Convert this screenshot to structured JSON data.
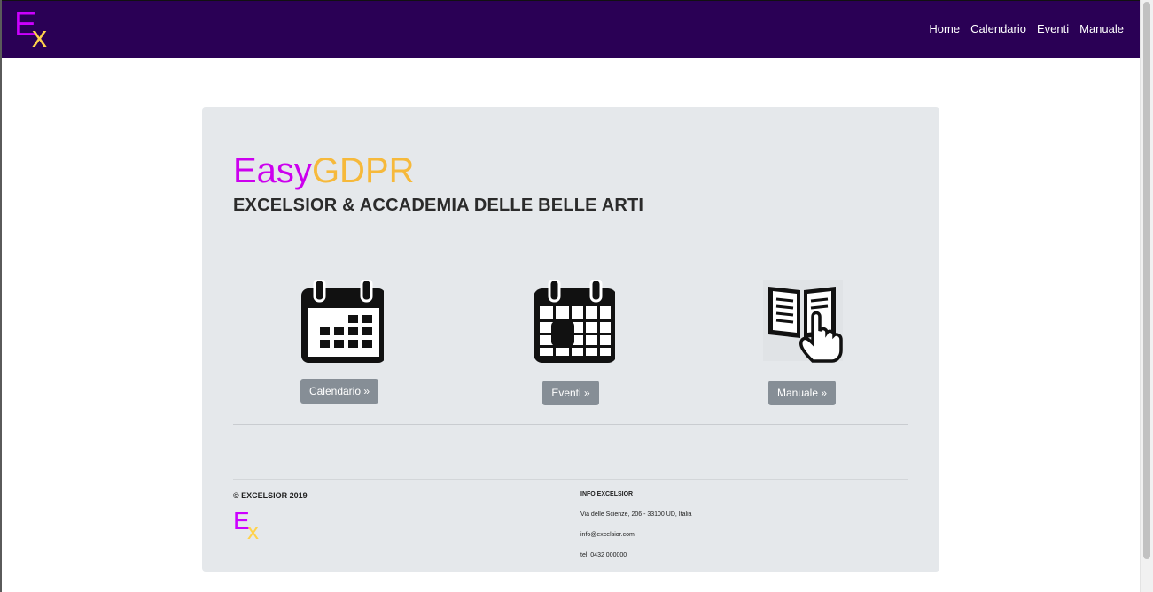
{
  "brand": {
    "logo_e": "E",
    "logo_x": "x"
  },
  "nav": {
    "items": [
      "Home",
      "Calendario",
      "Eventi",
      "Manuale"
    ]
  },
  "hero": {
    "title_part1": "Easy",
    "title_part2": "GDPR",
    "subtitle": "EXCELSIOR & ACCADEMIA DELLE BELLE ARTI"
  },
  "cards": [
    {
      "icon": "calendar-icon",
      "button": "Calendario »"
    },
    {
      "icon": "events-calendar-icon",
      "button": "Eventi »"
    },
    {
      "icon": "manual-book-icon",
      "button": "Manuale »"
    }
  ],
  "footer": {
    "copyright": "© EXCELSIOR 2019",
    "info_title": "INFO EXCELSIOR",
    "address": "Via delle Scienze, 206 - 33100 UD, Italia",
    "email": "info@excelsior.com",
    "phone": "tel. 0432 000000"
  },
  "colors": {
    "nav_bg": "#2a0055",
    "accent_purple": "#cc00ee",
    "accent_yellow": "#f6b93b",
    "card_bg": "#e5e8eb",
    "button_bg": "#868e96"
  }
}
